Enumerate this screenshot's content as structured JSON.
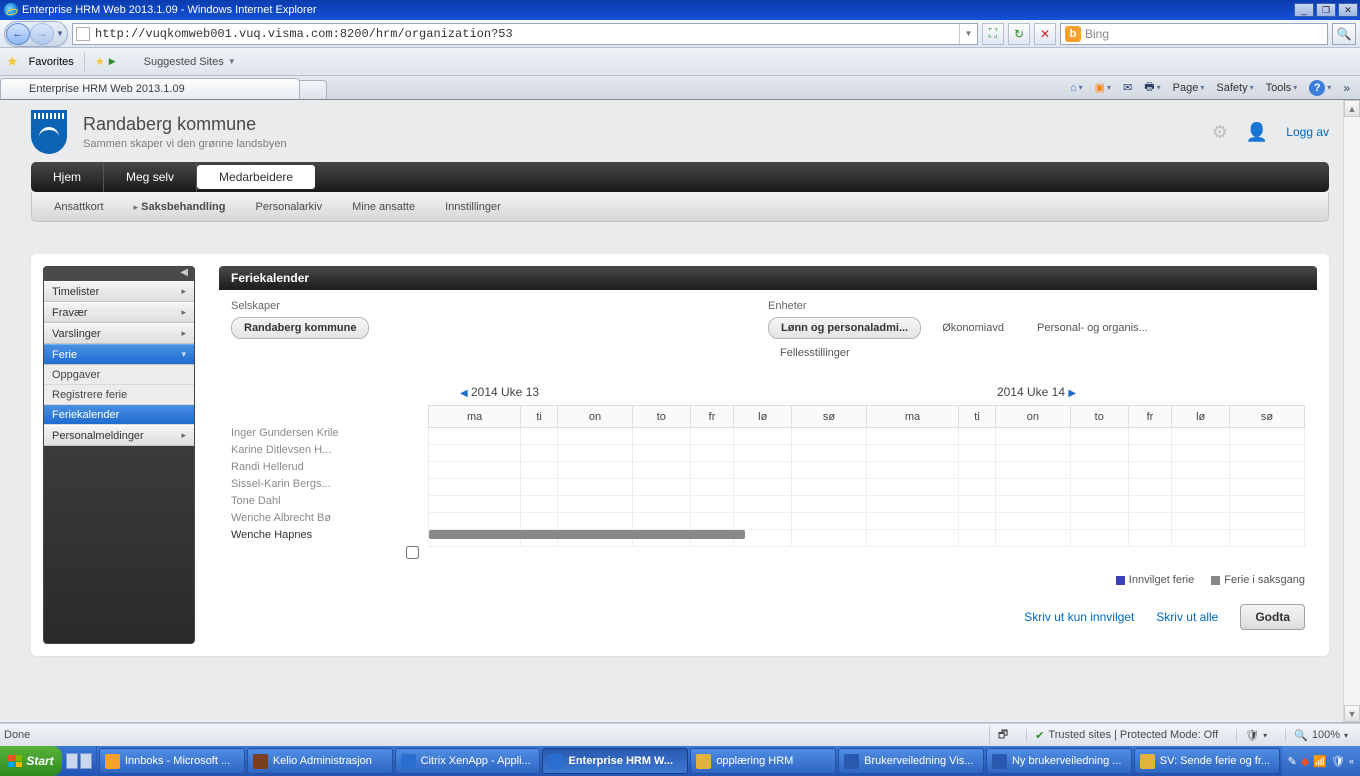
{
  "window": {
    "title": "Enterprise HRM Web 2013.1.09 - Windows Internet Explorer"
  },
  "address": {
    "url": "http://vuqkomweb001.vuq.visma.com:8200/hrm/organization?53"
  },
  "search": {
    "engine": "Bing"
  },
  "favorites": {
    "label": "Favorites",
    "suggested": "Suggested Sites"
  },
  "tab": {
    "title": "Enterprise HRM Web 2013.1.09"
  },
  "cmdbar": {
    "page": "Page",
    "safety": "Safety",
    "tools": "Tools"
  },
  "org": {
    "name": "Randaberg kommune",
    "tagline": "Sammen skaper vi den grønne landsbyen",
    "logoff": "Logg av"
  },
  "mainnav": {
    "home": "Hjem",
    "self": "Meg selv",
    "emp": "Medarbeidere"
  },
  "subnav": {
    "card": "Ansattkort",
    "case": "Saksbehandling",
    "archive": "Personalarkiv",
    "mine": "Mine ansatte",
    "settings": "Innstillinger"
  },
  "side": {
    "timelister": "Timelister",
    "fravar": "Fravær",
    "varslinger": "Varslinger",
    "ferie": "Ferie",
    "oppgaver": "Oppgaver",
    "registrere": "Registrere ferie",
    "kalender": "Feriekalender",
    "personal": "Personalmeldinger"
  },
  "panel": {
    "title": "Feriekalender"
  },
  "filters": {
    "companies_label": "Selskaper",
    "company_pill": "Randaberg kommune",
    "units_label": "Enheter",
    "unit_pill": "Lønn og personaladmi...",
    "unit_2": "Økonomiavd",
    "unit_3": "Personal- og organis...",
    "unit_4": "Fellesstillinger"
  },
  "weeks": {
    "left": "2014 Uke 13",
    "right": "2014 Uke 14"
  },
  "days": [
    "ma",
    "ti",
    "on",
    "to",
    "fr",
    "lø",
    "sø",
    "ma",
    "ti",
    "on",
    "to",
    "fr",
    "lø",
    "sø"
  ],
  "employees": [
    "Inger Gundersen Krile",
    "Karine Ditlevsen H...",
    "Randi Hellerud",
    "Sissel-Karin Bergs...",
    "Tone Dahl",
    "Wenche Albrecht Bø",
    "Wenche Hapnes"
  ],
  "legend": {
    "approved": "Innvilget ferie",
    "pending": "Ferie i saksgang"
  },
  "actions": {
    "print_approved": "Skriv ut kun innvilget",
    "print_all": "Skriv ut alle",
    "accept": "Godta"
  },
  "status": {
    "done": "Done",
    "zone": "Trusted sites | Protected Mode: Off",
    "zoom": "100%"
  },
  "taskbar": {
    "start": "Start",
    "items": [
      "Innboks - Microsoft ...",
      "Kelio Administrasjon",
      "Citrix XenApp - Appli...",
      "Enterprise HRM W...",
      "opplæring HRM",
      "Brukerveiledning Vis...",
      "Ny brukerveiledning ...",
      "SV: Sende ferie og fr..."
    ]
  }
}
